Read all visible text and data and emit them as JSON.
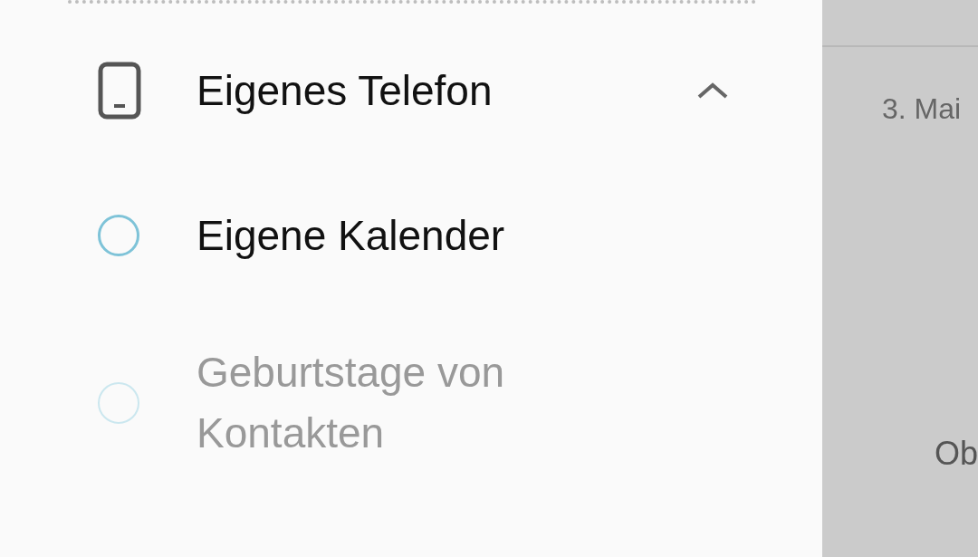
{
  "section": {
    "title": "Eigenes Telefon",
    "expanded": true
  },
  "calendars": [
    {
      "name": "Eigene Kalender",
      "enabled": true,
      "color": "#7ec3d8"
    },
    {
      "name": "Geburtstage von Kontakten",
      "enabled": false,
      "color": "#cbe7ef"
    }
  ],
  "background": {
    "date": "3. Mai",
    "text": "Ob"
  }
}
